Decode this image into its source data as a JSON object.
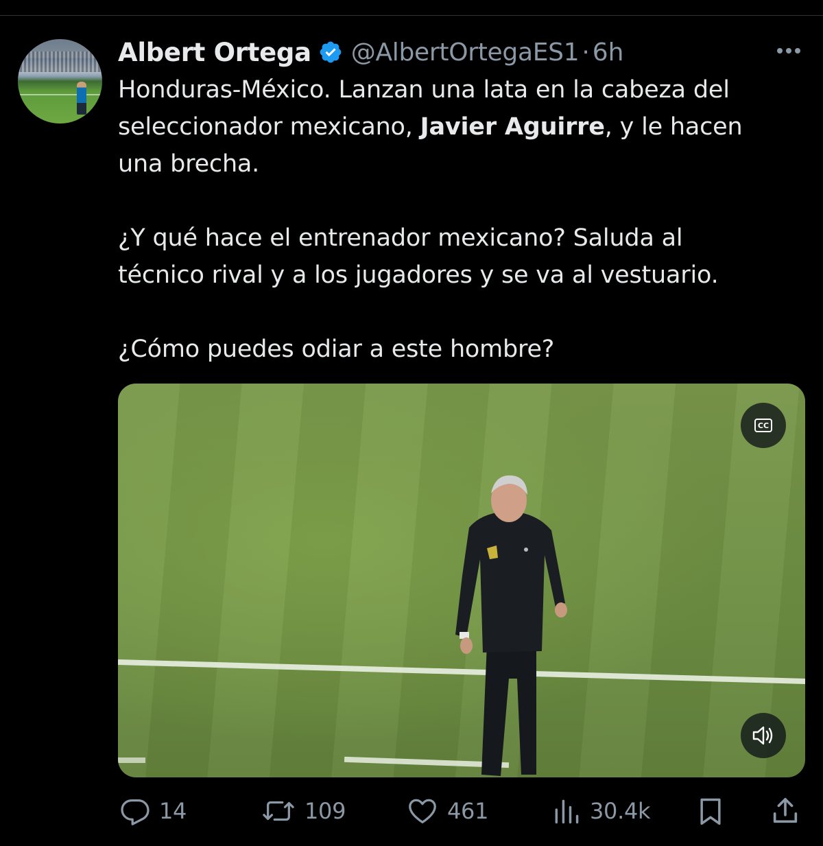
{
  "tweet": {
    "author": {
      "name": "Albert Ortega",
      "handle": "@AlbertOrtegaES1",
      "time": "6h",
      "separator": "·",
      "verified": true,
      "verified_color": "#1d9bf0"
    },
    "text": {
      "p1_a": "Honduras-México. Lanzan una lata en la cabeza del",
      "p1_b_pre": "seleccionador mexicano, ",
      "p1_b_bold": "Javier Aguirre",
      "p1_b_post": ", y le hacen",
      "p1_c": "una brecha.",
      "p2_a": "¿Y qué hace el entrenador mexicano? Saluda al",
      "p2_b": "técnico rival y a los jugadores y se va al vestuario.",
      "p3": "¿Cómo puedes odiar a este hombre?"
    },
    "media": {
      "captions_label": "CC",
      "captions_icon": "cc-icon",
      "volume_icon": "speaker-icon"
    },
    "actions": {
      "replies": "14",
      "retweets": "109",
      "likes": "461",
      "views": "30.4k"
    }
  },
  "colors": {
    "background": "#000000",
    "text": "#e7e9ea",
    "muted": "#8b98a5",
    "accent": "#1d9bf0"
  }
}
